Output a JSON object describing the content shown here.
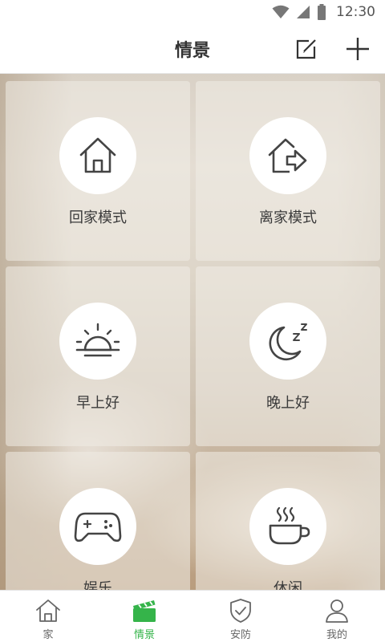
{
  "status_bar": {
    "time": "12:30",
    "icons": [
      "wifi-icon",
      "signal-icon",
      "battery-icon"
    ]
  },
  "app_bar": {
    "title": "情景",
    "actions": [
      "edit-icon",
      "plus-icon"
    ]
  },
  "scenes": [
    {
      "label": "回家模式",
      "icon": "home-icon"
    },
    {
      "label": "离家模式",
      "icon": "leave-home-icon"
    },
    {
      "label": "早上好",
      "icon": "sunrise-icon"
    },
    {
      "label": "晚上好",
      "icon": "moon-sleep-icon"
    },
    {
      "label": "娱乐",
      "icon": "gamepad-icon"
    },
    {
      "label": "休闲",
      "icon": "coffee-cup-icon"
    }
  ],
  "bottom_nav": {
    "active_index": 1,
    "active_color": "#35b44a",
    "items": [
      {
        "label": "家",
        "icon": "house-outline-icon"
      },
      {
        "label": "情景",
        "icon": "clapperboard-icon"
      },
      {
        "label": "安防",
        "icon": "shield-check-icon"
      },
      {
        "label": "我的",
        "icon": "person-icon"
      }
    ]
  }
}
